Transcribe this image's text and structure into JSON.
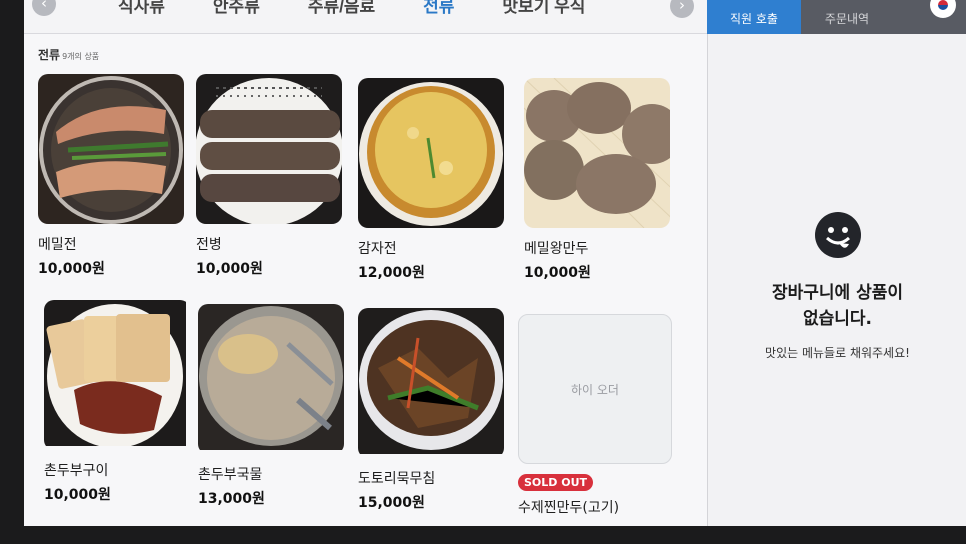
{
  "category_bar": {
    "tabs": [
      {
        "label": "식사류",
        "active": false
      },
      {
        "label": "안주류",
        "active": false
      },
      {
        "label": "주류/음료",
        "active": false
      },
      {
        "label": "전류",
        "active": true
      },
      {
        "label": "맛보기 우식",
        "active": false
      }
    ],
    "prev_arrow": "‹",
    "next_arrow": "›"
  },
  "side_tabs": {
    "call_staff": "직원 호출",
    "order_history": "주문내역",
    "language_icon": "korea-flag-icon"
  },
  "section": {
    "title": "전류",
    "count": "9개의 상품"
  },
  "items": [
    {
      "name": "메밀전",
      "price": "10,000원"
    },
    {
      "name": "전병",
      "price": "10,000원"
    },
    {
      "name": "감자전",
      "price": "12,000원"
    },
    {
      "name": "메밀왕만두",
      "price": "10,000원"
    },
    {
      "name": "촌두부구이",
      "price": "10,000원"
    },
    {
      "name": "촌두부국물",
      "price": "13,000원"
    },
    {
      "name": "도토리묵무침",
      "price": "15,000원"
    },
    {
      "name": "수제찐만두(고기)",
      "placeholder": "하이 오더",
      "badge": "SOLD OUT"
    }
  ],
  "cart": {
    "icon": "smile-tongue-icon",
    "empty_title_line1": "장바구니에 상품이",
    "empty_title_line2": "없습니다.",
    "empty_subtitle": "맛있는 메뉴들로 채워주세요!"
  },
  "colors": {
    "accent": "#2f7fd0",
    "active_tab": "#2a78c6",
    "sold_out": "#d8303c"
  }
}
